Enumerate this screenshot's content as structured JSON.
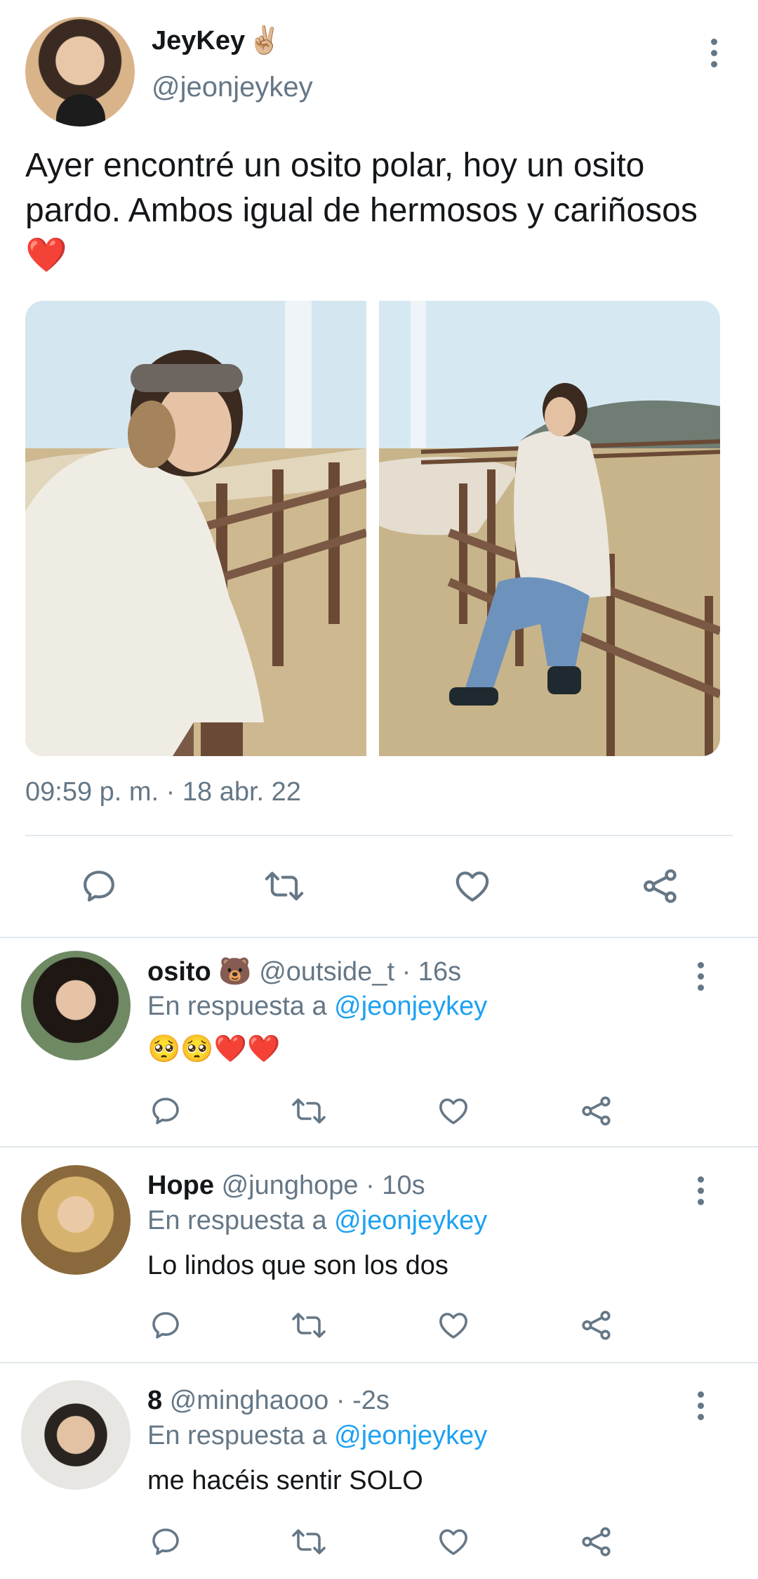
{
  "main_tweet": {
    "author_name": "JeyKey",
    "author_emoji": "✌🏼",
    "author_handle": "@jeonjeykey",
    "text": "Ayer encontré un osito polar, hoy un osito pardo. Ambos igual de hermosos y cariñosos ❤️",
    "timestamp": "09:59 p. m. · 18 abr. 22",
    "actions": [
      "reply-icon",
      "retweet-icon",
      "like-icon",
      "share-icon"
    ]
  },
  "replies": [
    {
      "name": "osito 🐻",
      "handle": "@outside_t",
      "time": "· 16s",
      "reply_prefix": "En respuesta a",
      "reply_mention": "@jeonjeykey",
      "text": "🥺🥺❤️❤️"
    },
    {
      "name": "Hope",
      "handle": "@junghope",
      "time": "· 10s",
      "reply_prefix": "En respuesta a",
      "reply_mention": "@jeonjeykey",
      "text": "Lo lindos que son los dos"
    },
    {
      "name": "8",
      "handle": "@minghaooo",
      "time": "· -2s",
      "reply_prefix": "En respuesta a",
      "reply_mention": "@jeonjeykey",
      "text": "me hacéis sentir SOLO"
    }
  ],
  "colors": {
    "text_primary": "#14171a",
    "text_secondary": "#657786",
    "link": "#1da1f2",
    "divider": "#e1e8ed",
    "heart": "#e0245e"
  }
}
